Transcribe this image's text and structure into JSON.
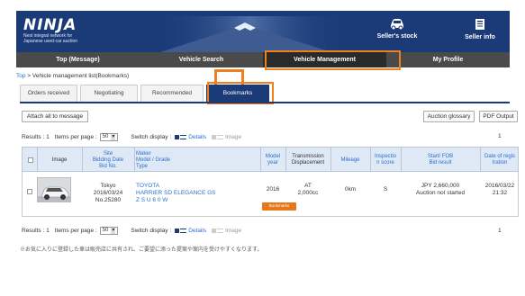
{
  "brand": {
    "logo": "NINJA",
    "tagline_line1": "Nest integral network for",
    "tagline_line2": "Japanese used-car auction"
  },
  "header_buttons": [
    {
      "label": "Seller's stock",
      "icon": "car-icon"
    },
    {
      "label": "Seller info",
      "icon": "document-icon"
    }
  ],
  "nav": [
    "Top (Message)",
    "Vehicle Search",
    "Vehicle Management",
    "My Profile"
  ],
  "breadcrumb": {
    "top": "Top",
    "sep": " > ",
    "current": "Vehicle management list(Bookmarks)"
  },
  "tabs": [
    "Orders received",
    "Negotiating",
    "Recommended",
    "Bookmarks"
  ],
  "actions": {
    "attach_all": "Attach all to message",
    "auction_glossary": "Auction glossary",
    "pdf_output": "PDF Output"
  },
  "toolbar": {
    "results": "Results : 1",
    "items_per_page": "Items per page :",
    "per_page_value": "50",
    "switch_display": "Switch display :",
    "details": "Details",
    "image": "Image",
    "page": "1"
  },
  "table": {
    "headers": {
      "image": "Image",
      "site": [
        "Site",
        "Bidding Date",
        "Bid No."
      ],
      "maker": [
        "Maker",
        "Model / Grade",
        "Type"
      ],
      "model_year": [
        "Model",
        "year"
      ],
      "transmission": [
        "Transmission",
        "Displacement"
      ],
      "mileage": "Mileage",
      "inspection": [
        "Inspectio",
        "n score"
      ],
      "start": [
        "Start/ FOB",
        "Bid result"
      ],
      "reg_date": [
        "Date of regis",
        "tration"
      ]
    },
    "rows": [
      {
        "site": "Tokyo",
        "date": "2016/03/24",
        "bid_no": "No.25280",
        "maker": "TOYOTA",
        "model": "HARRIER SD  ELEGANCE GS",
        "type": "Z S U 6 0 W",
        "year": "2016",
        "transmission": "AT",
        "displacement": "2,000cc",
        "mileage": "0km",
        "score": "S",
        "price": "JPY 2,660,000",
        "status": "Auction not started",
        "reg_date": "2016/03/22",
        "reg_time": "21:32",
        "bookmark_btn": "Bookmarks"
      }
    ]
  },
  "note": "※お気に入りに登録した車は販売店に共有され、ご要望に添った提案や案内を受けやすくなります。",
  "colors": {
    "brand_navy": "#1a3a78",
    "nav_dark": "#4a4a4a",
    "accent_orange": "#f07f1d",
    "link_blue": "#2a6fd0"
  }
}
